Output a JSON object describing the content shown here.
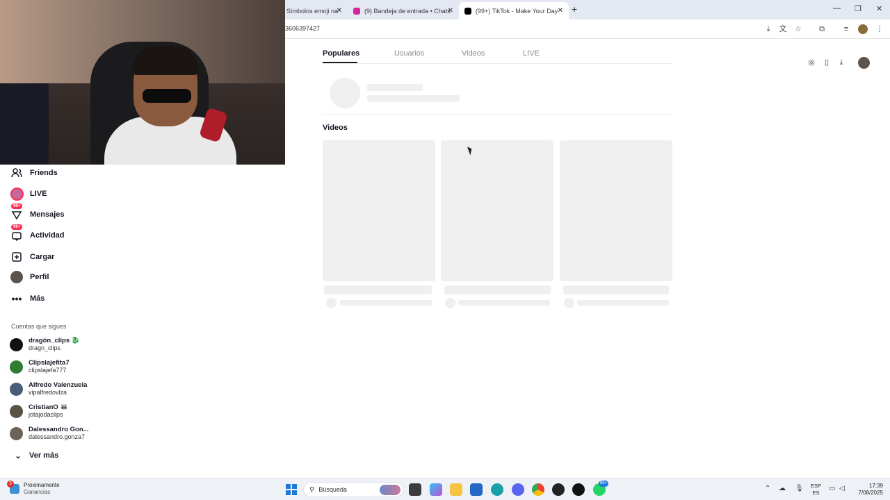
{
  "browser": {
    "tabs": [
      {
        "title": "Símbolos emoji na",
        "favicon_color": "#e0e0e0"
      },
      {
        "title": "(9) Bandeja de entrada • Chats",
        "favicon_color": "#d6249f"
      },
      {
        "title": "(99+) TikTok - Make Your Day",
        "favicon_color": "#000000"
      }
    ],
    "new_tab": "+",
    "window_controls": {
      "minimize": "—",
      "maximize": "❐",
      "close": "✕"
    },
    "url": "3606397427",
    "toolbar_icons": [
      "install-icon",
      "translate-icon",
      "star-icon",
      "extensions-icon",
      "media-icon",
      "profile-icon",
      "menu-icon"
    ]
  },
  "sidebar": {
    "items": [
      {
        "label": "Friends",
        "icon": "friends-icon"
      },
      {
        "label": "LIVE",
        "icon": "live-icon"
      },
      {
        "label": "Mensajes",
        "icon": "messages-icon",
        "badge": "99+"
      },
      {
        "label": "Actividad",
        "icon": "activity-icon",
        "badge": "99+"
      },
      {
        "label": "Cargar",
        "icon": "upload-icon"
      },
      {
        "label": "Perfil",
        "icon": "profile-avatar"
      },
      {
        "label": "Más",
        "icon": "more-icon"
      }
    ],
    "following_title": "Cuentas que sigues",
    "accounts": [
      {
        "name": "dragón_clips 🐉",
        "handle": "dragn_clips",
        "avatar_color": "#111111"
      },
      {
        "name": "Clipslajefita7",
        "handle": "clipslajefa777",
        "avatar_color": "#2e7d32"
      },
      {
        "name": "Alfredo Valenzuela",
        "handle": "vipalfredovlza",
        "avatar_color": "#4a5d78"
      },
      {
        "name": "CristianO 🦝",
        "handle": "jotajodaclips",
        "avatar_color": "#5b5246"
      },
      {
        "name": "Dalessandro Gon...",
        "handle": "dalessandro.gonza7",
        "avatar_color": "#6d6258"
      }
    ],
    "see_more": "Ver más"
  },
  "search": {
    "tabs": [
      "Populares",
      "Usuarios",
      "Videos",
      "LIVE"
    ],
    "active_tab": "Populares",
    "videos_heading": "Videos"
  },
  "taskbar": {
    "weather_line1": "Próximamente",
    "weather_line2": "Ganancias",
    "weather_badge": "3",
    "search_placeholder": "Búsqueda",
    "app_badge": "99+",
    "lang_line1": "ESP",
    "lang_line2": "ES",
    "time": "17:39",
    "date": "7/08/2025"
  },
  "colors": {
    "accent": "#fe2c55",
    "skeleton": "#efefef",
    "text": "#161823"
  }
}
